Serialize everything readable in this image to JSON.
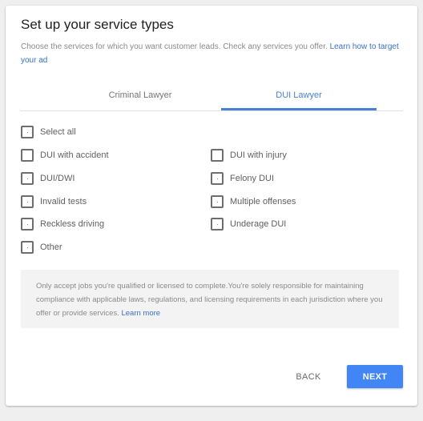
{
  "dialog": {
    "title": "Set up your service types",
    "subtitle": "Choose the services for which you want customer leads. Check any services you offer. ",
    "subtitle_link": "Learn how to target your ad"
  },
  "tabs": [
    {
      "label": "Criminal Lawyer",
      "active": false
    },
    {
      "label": "DUI Lawyer",
      "active": true
    }
  ],
  "select_all": {
    "label": "Select all",
    "checked": false
  },
  "services": [
    {
      "label": "DUI with accident",
      "checked": false
    },
    {
      "label": "DUI with injury",
      "checked": false
    },
    {
      "label": "DUI/DWI",
      "checked": false
    },
    {
      "label": "Felony DUI",
      "checked": false
    },
    {
      "label": "Invalid tests",
      "checked": false
    },
    {
      "label": "Multiple offenses",
      "checked": false
    },
    {
      "label": "Reckless driving",
      "checked": false
    },
    {
      "label": "Underage DUI",
      "checked": false
    },
    {
      "label": "Other",
      "checked": false
    }
  ],
  "notice": {
    "text": "Only accept jobs you're qualified or licensed to complete.You're solely responsible for maintaining compliance with applicable laws, regulations, and licensing requirements in each jurisdiction where you offer or provide services. ",
    "link": "Learn more"
  },
  "actions": {
    "back_label": "BACK",
    "next_label": "NEXT"
  },
  "colors": {
    "accent": "#4285f4",
    "tab_active": "#4a7fd4",
    "link": "#3b6fc9"
  }
}
